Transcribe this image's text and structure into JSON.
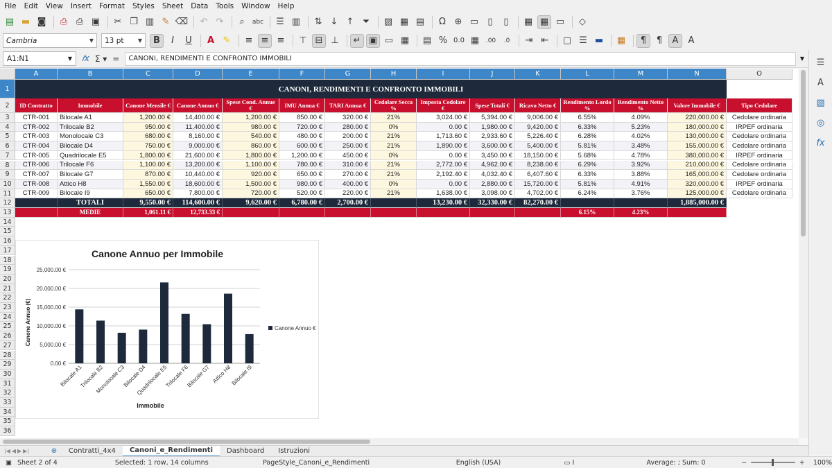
{
  "menu": [
    "File",
    "Edit",
    "View",
    "Insert",
    "Format",
    "Styles",
    "Sheet",
    "Data",
    "Tools",
    "Window",
    "Help"
  ],
  "toolbar": {
    "font_name": "Cambria",
    "font_size": "13 pt"
  },
  "formula_bar": {
    "name_box": "A1:N1",
    "content": "CANONI, RENDIMENTI E CONFRONTO IMMOBILI"
  },
  "columns": [
    "A",
    "B",
    "C",
    "D",
    "E",
    "F",
    "G",
    "H",
    "I",
    "J",
    "K",
    "L",
    "M",
    "N",
    "O"
  ],
  "rows": [
    "1",
    "2",
    "3",
    "4",
    "5",
    "6",
    "7",
    "8",
    "9",
    "10",
    "11",
    "12",
    "13",
    "14",
    "15",
    "16",
    "17",
    "18",
    "19",
    "20",
    "21",
    "22",
    "23",
    "24",
    "25",
    "26",
    "27",
    "28",
    "29",
    "30",
    "31",
    "32",
    "33",
    "34",
    "35",
    "36"
  ],
  "sheet": {
    "title": "CANONI, RENDIMENTI E CONFRONTO IMMOBILI",
    "headers": [
      "ID Contratto",
      "Immobile",
      "Canone Mensile €",
      "Canone Annuo €",
      "Spese Cond. Annue €",
      "IMU Annua €",
      "TARI Annua €",
      "Cedolare Secca %",
      "Imposta Cedolare €",
      "Spese Totali €",
      "Ricavo Netto €",
      "Rendimento Lordo %",
      "Rendimento Netto %",
      "Valore Immobile €",
      "Tipo Cedolare"
    ],
    "data": [
      [
        "CTR-001",
        "Bilocale A1",
        "1,200.00 €",
        "14,400.00 €",
        "1,200.00 €",
        "850.00 €",
        "320.00 €",
        "21%",
        "3,024.00 €",
        "5,394.00 €",
        "9,006.00 €",
        "6.55%",
        "4.09%",
        "220,000.00 €",
        "Cedolare ordinaria"
      ],
      [
        "CTR-002",
        "Trilocale B2",
        "950.00 €",
        "11,400.00 €",
        "980.00 €",
        "720.00 €",
        "280.00 €",
        "0%",
        "0.00 €",
        "1,980.00 €",
        "9,420.00 €",
        "6.33%",
        "5.23%",
        "180,000.00 €",
        "IRPEF ordinaria"
      ],
      [
        "CTR-003",
        "Monolocale C3",
        "680.00 €",
        "8,160.00 €",
        "540.00 €",
        "480.00 €",
        "200.00 €",
        "21%",
        "1,713.60 €",
        "2,933.60 €",
        "5,226.40 €",
        "6.28%",
        "4.02%",
        "130,000.00 €",
        "Cedolare ordinaria"
      ],
      [
        "CTR-004",
        "Bilocale D4",
        "750.00 €",
        "9,000.00 €",
        "860.00 €",
        "600.00 €",
        "250.00 €",
        "21%",
        "1,890.00 €",
        "3,600.00 €",
        "5,400.00 €",
        "5.81%",
        "3.48%",
        "155,000.00 €",
        "Cedolare ordinaria"
      ],
      [
        "CTR-005",
        "Quadrilocale E5",
        "1,800.00 €",
        "21,600.00 €",
        "1,800.00 €",
        "1,200.00 €",
        "450.00 €",
        "0%",
        "0.00 €",
        "3,450.00 €",
        "18,150.00 €",
        "5.68%",
        "4.78%",
        "380,000.00 €",
        "IRPEF ordinaria"
      ],
      [
        "CTR-006",
        "Trilocale F6",
        "1,100.00 €",
        "13,200.00 €",
        "1,100.00 €",
        "780.00 €",
        "310.00 €",
        "21%",
        "2,772.00 €",
        "4,962.00 €",
        "8,238.00 €",
        "6.29%",
        "3.92%",
        "210,000.00 €",
        "Cedolare ordinaria"
      ],
      [
        "CTR-007",
        "Bilocale G7",
        "870.00 €",
        "10,440.00 €",
        "920.00 €",
        "650.00 €",
        "270.00 €",
        "21%",
        "2,192.40 €",
        "4,032.40 €",
        "6,407.60 €",
        "6.33%",
        "3.88%",
        "165,000.00 €",
        "Cedolare ordinaria"
      ],
      [
        "CTR-008",
        "Attico H8",
        "1,550.00 €",
        "18,600.00 €",
        "1,500.00 €",
        "980.00 €",
        "400.00 €",
        "0%",
        "0.00 €",
        "2,880.00 €",
        "15,720.00 €",
        "5.81%",
        "4.91%",
        "320,000.00 €",
        "IRPEF ordinaria"
      ],
      [
        "CTR-009",
        "Bilocale I9",
        "650.00 €",
        "7,800.00 €",
        "720.00 €",
        "520.00 €",
        "220.00 €",
        "21%",
        "1,638.00 €",
        "3,098.00 €",
        "4,702.00 €",
        "6.24%",
        "3.76%",
        "125,000.00 €",
        "Cedolare ordinaria"
      ]
    ],
    "totals": [
      "",
      "TOTALI",
      "9,550.00 €",
      "114,600.00 €",
      "9,620.00 €",
      "6,780.00 €",
      "2,700.00 €",
      "",
      "13,230.00 €",
      "32,330.00 €",
      "82,270.00 €",
      "",
      "",
      "1,885,000.00 €"
    ],
    "averages": [
      "",
      "MEDIE",
      "1,061.11 €",
      "12,733.33 €",
      "",
      "",
      "",
      "",
      "",
      "",
      "",
      "6.15%",
      "4.23%",
      ""
    ]
  },
  "chart_data": {
    "type": "bar",
    "title": "Canone Annuo per Immobile",
    "xlabel": "Immobile",
    "ylabel": "Canone Annuo (€)",
    "categories": [
      "Bilocale A1",
      "Trilocale B2",
      "Monolocale C3",
      "Bilocale D4",
      "Quadrilocale E5",
      "Trilocale F6",
      "Bilocale G7",
      "Attico H8",
      "Bilocale I9"
    ],
    "series": [
      {
        "name": "Canone Annuo €",
        "values": [
          14400,
          11400,
          8160,
          9000,
          21600,
          13200,
          10440,
          18600,
          7800
        ]
      }
    ],
    "yticks": [
      "0.00 €",
      "5,000.00 €",
      "10,000.00 €",
      "15,000.00 €",
      "20,000.00 €",
      "25,000.00 €"
    ],
    "ylim": [
      0,
      25000
    ],
    "legend": "right",
    "bar_color": "#1e2a3b"
  },
  "tabs": [
    "Contratti_4x4",
    "Canoni_e_Rendimenti",
    "Dashboard",
    "Istruzioni"
  ],
  "active_tab": "Canoni_e_Rendimenti",
  "status": {
    "sheet": "Sheet 2 of 4",
    "selection": "Selected: 1 row, 14 columns",
    "page_style": "PageStyle_Canoni_e_Rendimenti",
    "language": "English (USA)",
    "summary": "Average: ; Sum: 0",
    "zoom": "100%"
  },
  "colors": {
    "title_bg": "#1e2a3b",
    "header_red": "#c8102e",
    "highlight_yellow": "#fdf7df",
    "selection_blue": "#3d86c8"
  }
}
